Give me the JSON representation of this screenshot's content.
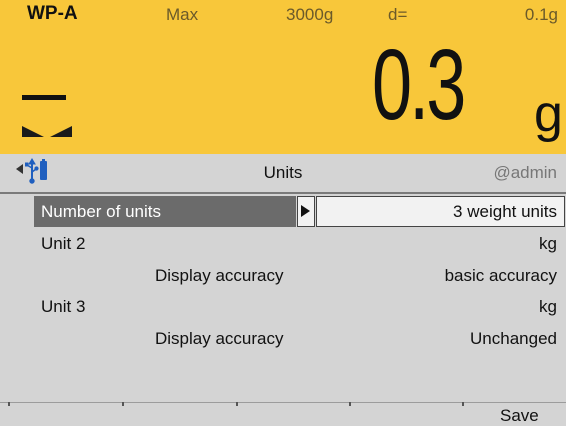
{
  "header": {
    "model": "WP-A",
    "max_label": "Max",
    "max_value": "3000g",
    "d_label": "d=",
    "d_value": "0.1g"
  },
  "reading": {
    "sign": "–",
    "value": "0.3",
    "unit": "g"
  },
  "titlebar": {
    "title": "Units",
    "user": "@admin",
    "icons": [
      "nav-left-icon",
      "usb-icon",
      "battery-icon"
    ]
  },
  "menu": {
    "selected_label": "Number of units",
    "selected_value": "3 weight units",
    "rows": [
      {
        "label": "Unit 2",
        "value": "kg"
      },
      {
        "label": "Display accuracy",
        "value": "basic accuracy"
      },
      {
        "label": "Unit 3",
        "value": "kg"
      },
      {
        "label": "Display accuracy",
        "value": "Unchanged"
      }
    ]
  },
  "softkeys": {
    "key5": "Save"
  },
  "colors": {
    "display_bg": "#f8c73a",
    "panel_bg": "#d4d4d4",
    "selected_bg": "#6b6b6b"
  }
}
